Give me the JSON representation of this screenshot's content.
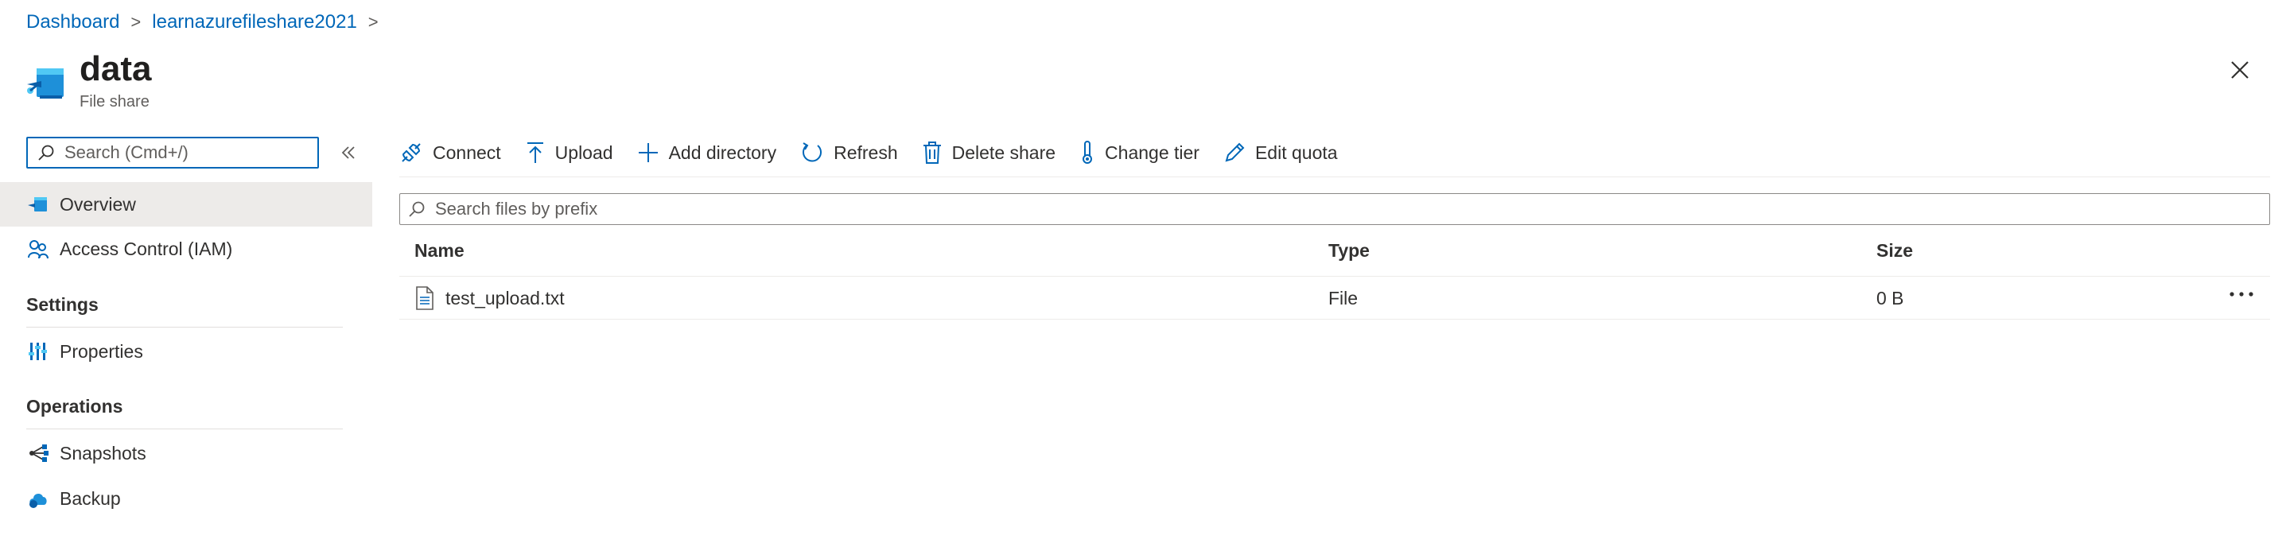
{
  "breadcrumb": {
    "items": [
      "Dashboard",
      "learnazurefileshare2021"
    ],
    "separator": ">"
  },
  "resource": {
    "title": "data",
    "subtitle": "File share",
    "icon": "file-share-icon"
  },
  "sidebar": {
    "search_placeholder": "Search (Cmd+/)",
    "items": [
      {
        "label": "Overview",
        "icon": "overview-icon",
        "selected": true
      },
      {
        "label": "Access Control (IAM)",
        "icon": "people-icon",
        "selected": false
      }
    ],
    "groups": [
      {
        "heading": "Settings",
        "items": [
          {
            "label": "Properties",
            "icon": "properties-icon"
          }
        ]
      },
      {
        "heading": "Operations",
        "items": [
          {
            "label": "Snapshots",
            "icon": "snapshots-icon"
          },
          {
            "label": "Backup",
            "icon": "backup-icon"
          }
        ]
      }
    ]
  },
  "toolbar": {
    "connect": "Connect",
    "upload": "Upload",
    "add_directory": "Add directory",
    "refresh": "Refresh",
    "delete_share": "Delete share",
    "change_tier": "Change tier",
    "edit_quota": "Edit quota"
  },
  "files": {
    "search_placeholder": "Search files by prefix",
    "columns": [
      "Name",
      "Type",
      "Size"
    ],
    "rows": [
      {
        "name": "test_upload.txt",
        "type": "File",
        "size": "0 B"
      }
    ]
  },
  "colors": {
    "accent": "#0067b8",
    "selected_bg": "#edebe9",
    "text": "#323130"
  }
}
